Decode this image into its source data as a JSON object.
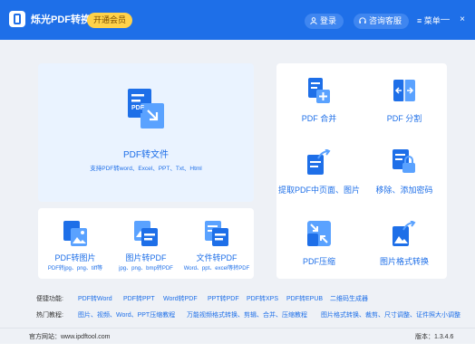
{
  "header": {
    "title": "烁光PDF转换器",
    "vip_label": "开通会员",
    "login_label": "登录",
    "service_label": "咨询客服",
    "menu_label": "菜单",
    "minimize": "—",
    "close": "×",
    "accent_color": "#1e6fe8"
  },
  "main_tool": {
    "label": "PDF转文件",
    "sub": "支持PDF转word、Excel、PPT、Txt、Html",
    "icon_text": "PDF"
  },
  "left_tools": [
    {
      "label": "PDF转图片",
      "sub": "PDF转jpg、png、tiff等"
    },
    {
      "label": "图片转PDF",
      "sub": "jpg、png、bmp转PDF"
    },
    {
      "label": "文件转PDF",
      "sub": "Word、ppt、excel等转PDF"
    }
  ],
  "right_tools": [
    {
      "label": "PDF 合并"
    },
    {
      "label": "PDF 分割"
    },
    {
      "label": "提取PDF中页面、图片"
    },
    {
      "label": "移除、添加密码"
    },
    {
      "label": "PDF压缩"
    },
    {
      "label": "图片格式转换"
    }
  ],
  "quick_links": {
    "label": "便捷功能:",
    "items": [
      "PDF转Word",
      "PDF转PPT",
      "Word转PDF",
      "PPT转PDF",
      "PDF转XPS",
      "PDF转EPUB",
      "二维码生成器"
    ]
  },
  "tutorials": {
    "label": "热门教程:",
    "items": [
      "图片、视频、Word、PPT压缩教程",
      "万能视频格式转换、剪辑、合并、压缩教程",
      "图片格式转换、裁剪、尺寸调整、证件照大小调整"
    ]
  },
  "footer": {
    "site": "官方网站：www.ipdftool.com",
    "version": "版本：1.3.4.6"
  }
}
